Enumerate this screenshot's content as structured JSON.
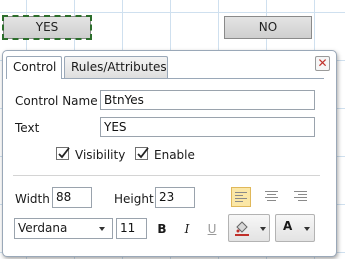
{
  "canvas": {
    "yes_button_label": "YES",
    "no_button_label": "NO"
  },
  "panel": {
    "tabs": [
      {
        "label": "Control",
        "active": true
      },
      {
        "label": "Rules/Attributes",
        "active": false
      }
    ],
    "close_icon": "close-icon",
    "control_name_label": "Control Name",
    "control_name_value": "BtnYes",
    "text_label": "Text",
    "text_value": "YES",
    "visibility_label": "Visibility",
    "visibility_checked": true,
    "enable_label": "Enable",
    "enable_checked": true,
    "width_label": "Width",
    "width_value": "88",
    "height_label": "Height",
    "height_value": "23",
    "text_align": "left",
    "font_family": "Verdana",
    "font_size": "11",
    "bold_label": "B",
    "italic_label": "I",
    "underline_label": "U",
    "fill_color_icon": "paint-bucket-icon",
    "font_color_label": "A",
    "accent_color": "#fbe7a6"
  }
}
